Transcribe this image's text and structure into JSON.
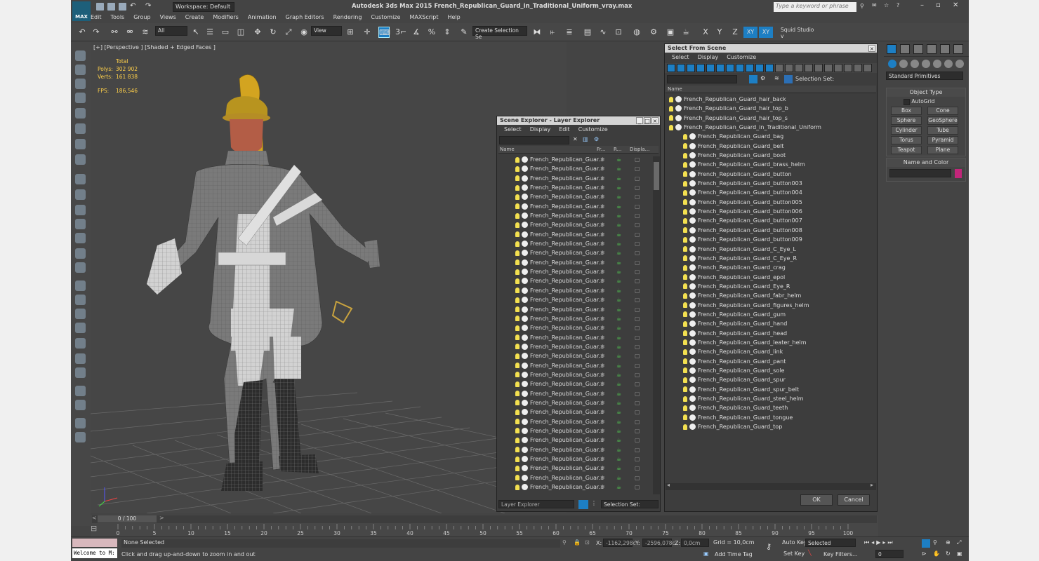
{
  "app": {
    "title": "Autodesk 3ds Max  2015     French_Republican_Guard_in_Traditional_Uniform_vray.max",
    "logo": "MAX",
    "workspace": "Workspace: Default",
    "search_placeholder": "Type a keyword or phrase"
  },
  "menu": [
    "Edit",
    "Tools",
    "Group",
    "Views",
    "Create",
    "Modifiers",
    "Animation",
    "Graph Editors",
    "Rendering",
    "Customize",
    "MAXScript",
    "Help"
  ],
  "toolbar": {
    "filter": "All",
    "ref_coord": "View",
    "selection_set": "Create Selection Se",
    "axes": [
      "X",
      "Y",
      "Z",
      "XY",
      "XY"
    ],
    "studio": "Squid Studio v"
  },
  "viewport": {
    "label": "[+] [Perspective ] [Shaded + Edged Faces ]",
    "stats_header": "Total",
    "polys_label": "Polys:",
    "polys": "302 902",
    "verts_label": "Verts:",
    "verts": "161 838",
    "fps_label": "FPS:",
    "fps": "186,546"
  },
  "scene_explorer": {
    "title": "Scene Explorer - Layer Explorer",
    "menu": [
      "Select",
      "Display",
      "Edit",
      "Customize"
    ],
    "columns": [
      "Name",
      "Fr...",
      "R...",
      "Displa..."
    ],
    "row_label": "French_Republican_Guar...",
    "footer": "Layer Explorer",
    "selection_set": "Selection Set:"
  },
  "select_from_scene": {
    "title": "Select From Scene",
    "menu": [
      "Select",
      "Display",
      "Customize"
    ],
    "selection_set": "Selection Set:",
    "column": "Name",
    "items": [
      "French_Republican_Guard_hair_back",
      "French_Republican_Guard_hair_top_b",
      "French_Republican_Guard_hair_top_s",
      "French_Republican_Guard_in_Traditional_Uniform",
      "French_Republican_Guard_bag",
      "French_Republican_Guard_belt",
      "French_Republican_Guard_boot",
      "French_Republican_Guard_brass_helm",
      "French_Republican_Guard_button",
      "French_Republican_Guard_button003",
      "French_Republican_Guard_button004",
      "French_Republican_Guard_button005",
      "French_Republican_Guard_button006",
      "French_Republican_Guard_button007",
      "French_Republican_Guard_button008",
      "French_Republican_Guard_button009",
      "French_Republican_Guard_C_Eye_L",
      "French_Republican_Guard_C_Eye_R",
      "French_Republican_Guard_crag",
      "French_Republican_Guard_epol",
      "French_Republican_Guard_Eye_R",
      "French_Republican_Guard_fabr_helm",
      "French_Republican_Guard_figures_helm",
      "French_Republican_Guard_gum",
      "French_Republican_Guard_hand",
      "French_Republican_Guard_head",
      "French_Republican_Guard_leater_helm",
      "French_Republican_Guard_link",
      "French_Republican_Guard_pant",
      "French_Republican_Guard_sole",
      "French_Republican_Guard_spur",
      "French_Republican_Guard_spur_belt",
      "French_Republican_Guard_steel_helm",
      "French_Republican_Guard_teeth",
      "French_Republican_Guard_tongue",
      "French_Republican_Guard_top"
    ],
    "ok": "OK",
    "cancel": "Cancel"
  },
  "command_panel": {
    "dropdown": "Standard Primitives",
    "object_type": "Object Type",
    "autogrid": "AutoGrid",
    "primitives": [
      "Box",
      "Cone",
      "Sphere",
      "GeoSphere",
      "Cylinder",
      "Tube",
      "Torus",
      "Pyramid",
      "Teapot",
      "Plane"
    ],
    "name_and_color": "Name and Color",
    "swatch_color": "#c2267a"
  },
  "timeline": {
    "frame": "0 / 100",
    "ticks": [
      "0",
      "5",
      "10",
      "15",
      "20",
      "25",
      "30",
      "35",
      "40",
      "45",
      "50",
      "55",
      "60",
      "65",
      "70",
      "75",
      "80",
      "85",
      "90",
      "95",
      "100"
    ]
  },
  "status": {
    "maxscript": "Welcome to M:",
    "selected": "None Selected",
    "prompt": "Click and drag up-and-down to zoom in and out",
    "x_label": "X:",
    "x": "-1162,298c",
    "y_label": "Y:",
    "y": "-2596,078c",
    "z_label": "Z:",
    "z": "0,0cm",
    "grid": "Grid = 10,0cm",
    "add_time_tag": "Add Time Tag",
    "auto_key": "Auto Key",
    "set_key": "Set Key",
    "key_mode": "Selected",
    "key_filters": "Key Filters...",
    "frame_field": "0"
  }
}
